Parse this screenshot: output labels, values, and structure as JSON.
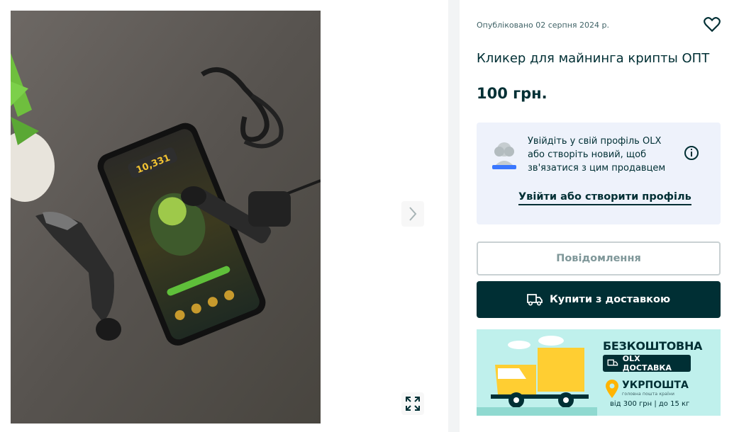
{
  "gallery": {
    "next_icon": "chevron-right-icon",
    "expand_icon": "expand-icon",
    "photo_icon": "product-photo"
  },
  "listing": {
    "posted": "Опубліковано 02 серпня 2024 р.",
    "favorite_icon": "heart-icon",
    "title": "Кликер для майнинга крипты ОПТ",
    "price": "100 грн."
  },
  "login_prompt": {
    "text": "Увійдіть у свій профіль OLX або створіть новий, щоб зв'язатися з цим продавцем",
    "link": "Увійти або створити профіль",
    "info_icon": "info-icon"
  },
  "actions": {
    "message_label": "Повідомлення",
    "buy_label": "Купити з доставкою",
    "buy_icon": "truck-icon"
  },
  "promo": {
    "free": "БЕЗКОШТОВНА",
    "badge": "OLX ДОСТАВКА",
    "carrier": "УКРПОШТА",
    "carrier_sub": "головна пошта країни",
    "terms": "від 300 грн | до 15 кг"
  },
  "colors": {
    "brand_dark": "#002f34",
    "promo_bg": "#bff0ec",
    "login_bg": "#eef2fb",
    "truck_yellow": "#ffce32"
  }
}
